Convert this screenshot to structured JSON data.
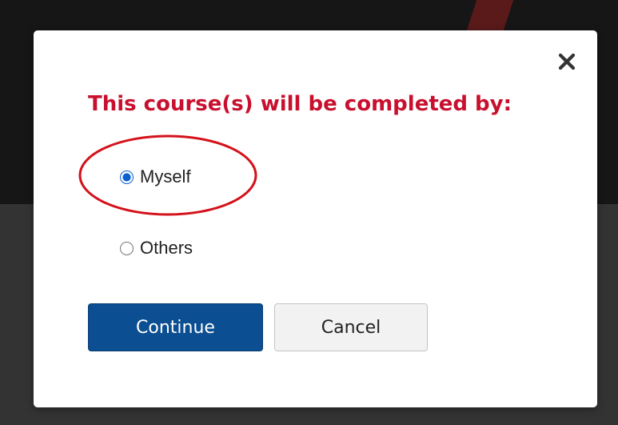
{
  "dialog": {
    "title": "This course(s) will be completed by:",
    "close_icon": "close-icon",
    "options": [
      {
        "label": "Myself",
        "selected": true
      },
      {
        "label": "Others",
        "selected": false
      }
    ],
    "continue_label": "Continue",
    "cancel_label": "Cancel"
  },
  "colors": {
    "title": "#c8102e",
    "primary_button": "#0b4e91",
    "annotation": "#d4121b",
    "radio_accent": "#0a5fd1"
  }
}
